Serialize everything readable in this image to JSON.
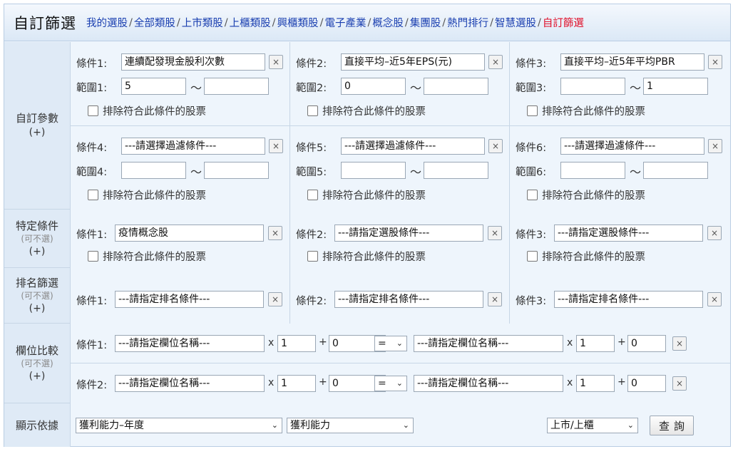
{
  "header": {
    "title": "自訂篩選",
    "nav": [
      "我的選股",
      "全部類股",
      "上市類股",
      "上櫃類股",
      "興櫃類股",
      "電子產業",
      "概念股",
      "集團股",
      "熱門排行",
      "智慧選股",
      "自訂篩選"
    ]
  },
  "custom": {
    "label": "自訂參數",
    "plus": "(+)",
    "conditions": [
      {
        "label": "條件1:",
        "value": "連續配發現金股利次數",
        "range_label": "範圍1:",
        "min": "5",
        "max": ""
      },
      {
        "label": "條件2:",
        "value": "直接平均–近5年EPS(元)",
        "range_label": "範圍2:",
        "min": "0",
        "max": ""
      },
      {
        "label": "條件3:",
        "value": "直接平均–近5年平均PBR",
        "range_label": "範圍3:",
        "min": "",
        "max": "1"
      },
      {
        "label": "條件4:",
        "value": "---請選擇過濾條件---",
        "range_label": "範圍4:",
        "min": "",
        "max": ""
      },
      {
        "label": "條件5:",
        "value": "---請選擇過濾條件---",
        "range_label": "範圍5:",
        "min": "",
        "max": ""
      },
      {
        "label": "條件6:",
        "value": "---請選擇過濾條件---",
        "range_label": "範圍6:",
        "min": "",
        "max": ""
      }
    ],
    "exclude_label": "排除符合此條件的股票",
    "tilde": "～",
    "clear": "×"
  },
  "specific": {
    "label": "特定條件",
    "optional": "(可不選)",
    "plus": "(+)",
    "conditions": [
      {
        "label": "條件1:",
        "value": "疫情概念股"
      },
      {
        "label": "條件2:",
        "value": "---請指定選股條件---"
      },
      {
        "label": "條件3:",
        "value": "---請指定選股條件---"
      }
    ]
  },
  "ranking": {
    "label": "排名篩選",
    "optional": "(可不選)",
    "plus": "(+)",
    "conditions": [
      {
        "label": "條件1:",
        "value": "---請指定排名條件---"
      },
      {
        "label": "條件2:",
        "value": "---請指定排名條件---"
      },
      {
        "label": "條件3:",
        "value": "---請指定排名條件---"
      }
    ]
  },
  "compare": {
    "label": "欄位比較",
    "optional": "(可不選)",
    "plus": "(+)",
    "rows": [
      {
        "label": "條件1:",
        "left": "---請指定欄位名稱---",
        "mul1": "1",
        "add1": "0",
        "op": "=",
        "right": "---請指定欄位名稱---",
        "mul2": "1",
        "add2": "0"
      },
      {
        "label": "條件2:",
        "left": "---請指定欄位名稱---",
        "mul1": "1",
        "add1": "0",
        "op": "=",
        "right": "---請指定欄位名稱---",
        "mul2": "1",
        "add2": "0"
      }
    ],
    "x": "x",
    "plus_op": "+"
  },
  "display": {
    "label": "顯示依據",
    "select1": "獲利能力–年度",
    "select2": "獲利能力",
    "market": "上市/上櫃",
    "query": "查詢",
    "arrow": "⌄"
  }
}
